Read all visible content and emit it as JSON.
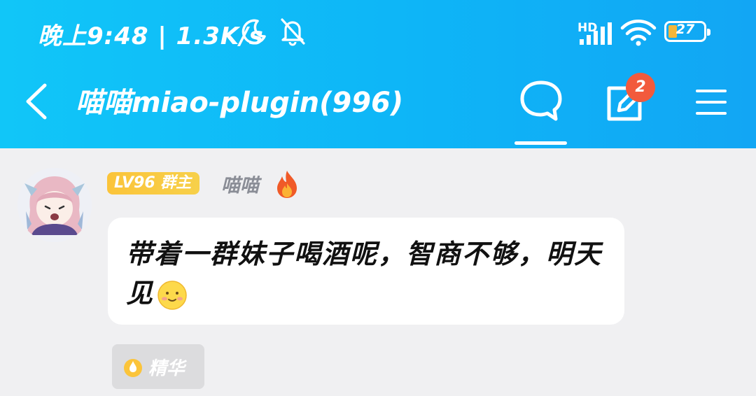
{
  "status_bar": {
    "time_speed": "晚上9:48 | 1.3K/s",
    "network_label": "HD",
    "battery_level": "27",
    "icons": [
      "moon-icon",
      "bell-off-icon",
      "signal-icon",
      "wifi-icon",
      "battery-icon"
    ]
  },
  "nav": {
    "title": "喵喵miao-plugin(996)",
    "notification_count": "2",
    "icons": [
      "back-arrow-icon",
      "chat-bubble-icon",
      "edit-icon",
      "menu-icon"
    ]
  },
  "message": {
    "level_badge": "LV96 群主",
    "username": "喵喵",
    "text": "带着一群妹子喝酒呢，智商不够，明天见",
    "emoji": "smiling-face-emoji",
    "essence_label": "精华"
  },
  "colors": {
    "header_gradient_start": "#11c6f8",
    "header_gradient_end": "#12a6f4",
    "badge_red": "#f25a3c",
    "level_gold": "#fbc43a",
    "background": "#f0f0f2"
  }
}
